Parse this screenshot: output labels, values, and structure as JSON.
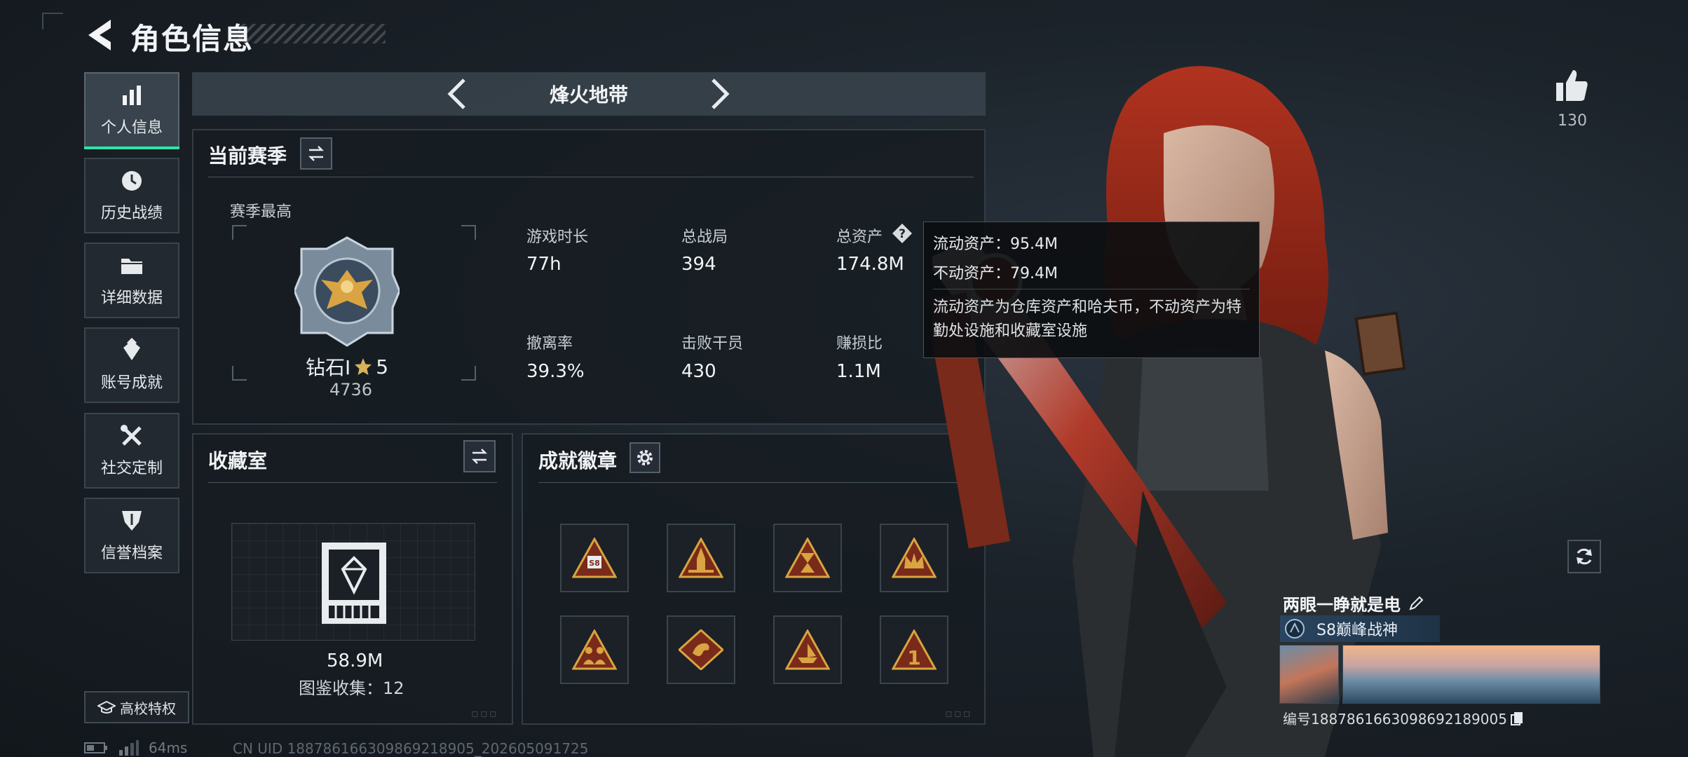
{
  "header": {
    "title": "角色信息"
  },
  "sidebar": {
    "items": [
      {
        "label": "个人信息",
        "icon": "bar-chart-icon",
        "active": true
      },
      {
        "label": "历史战绩",
        "icon": "history-clock-icon"
      },
      {
        "label": "详细数据",
        "icon": "folder-icon"
      },
      {
        "label": "账号成就",
        "icon": "achievement-icon"
      },
      {
        "label": "社交定制",
        "icon": "tools-icon"
      },
      {
        "label": "信誉档案",
        "icon": "shield-icon"
      }
    ],
    "school_label": "高校特权"
  },
  "mode": {
    "name": "烽火地带"
  },
  "season": {
    "title": "当前赛季",
    "best_label": "赛季最高",
    "rank_name": "钻石I",
    "rank_stars": "5",
    "rank_score": "4736",
    "stats": [
      {
        "label": "游戏时长",
        "value": "77h"
      },
      {
        "label": "总战局",
        "value": "394"
      },
      {
        "label": "总资产",
        "value": "174.8M"
      },
      {
        "label": "撤离率",
        "value": "39.3%"
      },
      {
        "label": "击败干员",
        "value": "430"
      },
      {
        "label": "赚损比",
        "value": "1.1M"
      }
    ]
  },
  "tooltip": {
    "line1": "流动资产：95.4M",
    "line2": "不动资产：79.4M",
    "desc": "流动资产为仓库资产和哈夫币，不动资产为特勤处设施和收藏室设施"
  },
  "collection": {
    "title": "收藏室",
    "value": "58.9M",
    "count_text": "图鉴收集：12"
  },
  "badges": {
    "title": "成就徽章",
    "items": [
      "s8-badge",
      "rocket-badge",
      "hourglass-badge",
      "crown-badge",
      "team-badge",
      "dragon-badge",
      "ship-badge",
      "number-one-badge"
    ]
  },
  "social": {
    "like_count": "130"
  },
  "player": {
    "name": "两眼一睁就是电",
    "title": "S8巅峰战神",
    "id_text": "编号1887861663098692189005"
  },
  "status": {
    "ping": "64ms",
    "uid": "CN UID 188786166309869218905_202605091725"
  },
  "colors": {
    "accent": "#2ee6a8",
    "badge_gold": "#d9a441",
    "badge_red": "#7a2a1a"
  }
}
